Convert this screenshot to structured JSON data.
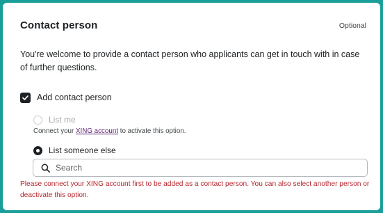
{
  "section": {
    "title": "Contact person",
    "optional_label": "Optional",
    "intro": "You're welcome to provide a contact person who applicants can get in touch with in case of further questions."
  },
  "add_contact": {
    "label": "Add contact person",
    "checked": true
  },
  "options": {
    "list_me": {
      "label": "List me",
      "disabled": true,
      "selected": false
    },
    "helper_before": "Connect your ",
    "helper_link": "XING account",
    "helper_after": " to activate this option.",
    "list_someone_else": {
      "label": "List someone else",
      "selected": true
    }
  },
  "search": {
    "placeholder": "Search",
    "value": ""
  },
  "error_message": "Please connect your XING account first to be added as a contact person. You can also select another person or deactivate this option.",
  "colors": {
    "frame": "#1a9e9a",
    "text": "#1d2124",
    "link": "#5c1e70",
    "error": "#b5262d"
  }
}
